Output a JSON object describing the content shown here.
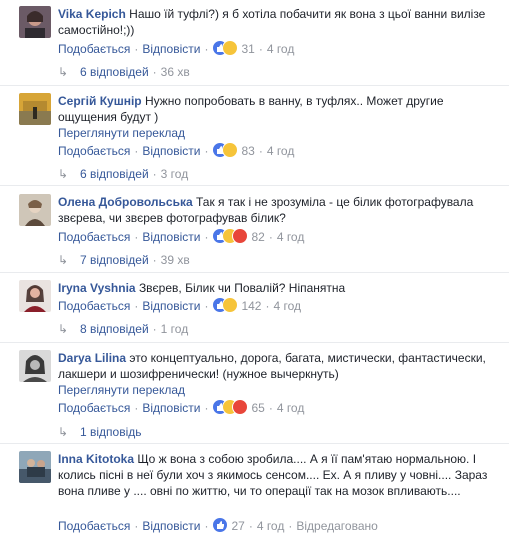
{
  "comments": [
    {
      "author": "Vika Kepich",
      "text": "Нашо їй туфлі?) я б хотіла побачити як вона з цьої ванни вилізе самостійно!;))",
      "like": "Подобається",
      "reply": "Відповісти",
      "reactions": "31",
      "time": "4 год",
      "replies": "6 відповідей",
      "replies_time": "36 хв"
    },
    {
      "author": "Сергій Кушнір",
      "text": "Нужно попробовать в ванну, в туфлях.. Может другие ощущения будут )",
      "translate": "Переглянути переклад",
      "like": "Подобається",
      "reply": "Відповісти",
      "reactions": "83",
      "time": "4 год",
      "replies": "6 відповідей",
      "replies_time": "3 год"
    },
    {
      "author": "Олена Добровольська",
      "text": "Так я так і не зрозуміла - це білик фотографувала звєрева, чи звєрев фотографував білик?",
      "like": "Подобається",
      "reply": "Відповісти",
      "reactions": "82",
      "time": "4 год",
      "replies": "7 відповідей",
      "replies_time": "39 хв"
    },
    {
      "author": "Iryna Vyshnia",
      "text": "Звєрев, Білик чи Повалій? Ніпанятна",
      "like": "Подобається",
      "reply": "Відповісти",
      "reactions": "142",
      "time": "4 год",
      "replies": "8 відповідей",
      "replies_time": "1 год"
    },
    {
      "author": "Darya Lilina",
      "text": "это концептуально, дорога, багата, мистически, фантастически, лакшери и шозифренически! (нужное вычеркнуть)",
      "translate": "Переглянути переклад",
      "like": "Подобається",
      "reply": "Відповісти",
      "reactions": "65",
      "time": "4 год",
      "replies": "1 відповідь",
      "replies_time": ""
    },
    {
      "author": "Inna Kitotoka",
      "text": "Що ж вона з собою зробила.... А я її пам'ятаю нормальною. І колись пісні в неї були хоч з якимось сенсом.... Ех. А я пливу у човні.... Зараз вона пливе у .... овні по життю, чи то операції так на мозок впливають....",
      "like": "Подобається",
      "reply": "Відповісти",
      "reactions": "27",
      "time": "4 год",
      "edited": "Відредаговано"
    }
  ],
  "colors": {
    "link": "#365899",
    "meta": "#90949c",
    "like_badge": "#4a76e8",
    "haha_badge": "#f6c43a",
    "angry_badge": "#e8463a"
  }
}
